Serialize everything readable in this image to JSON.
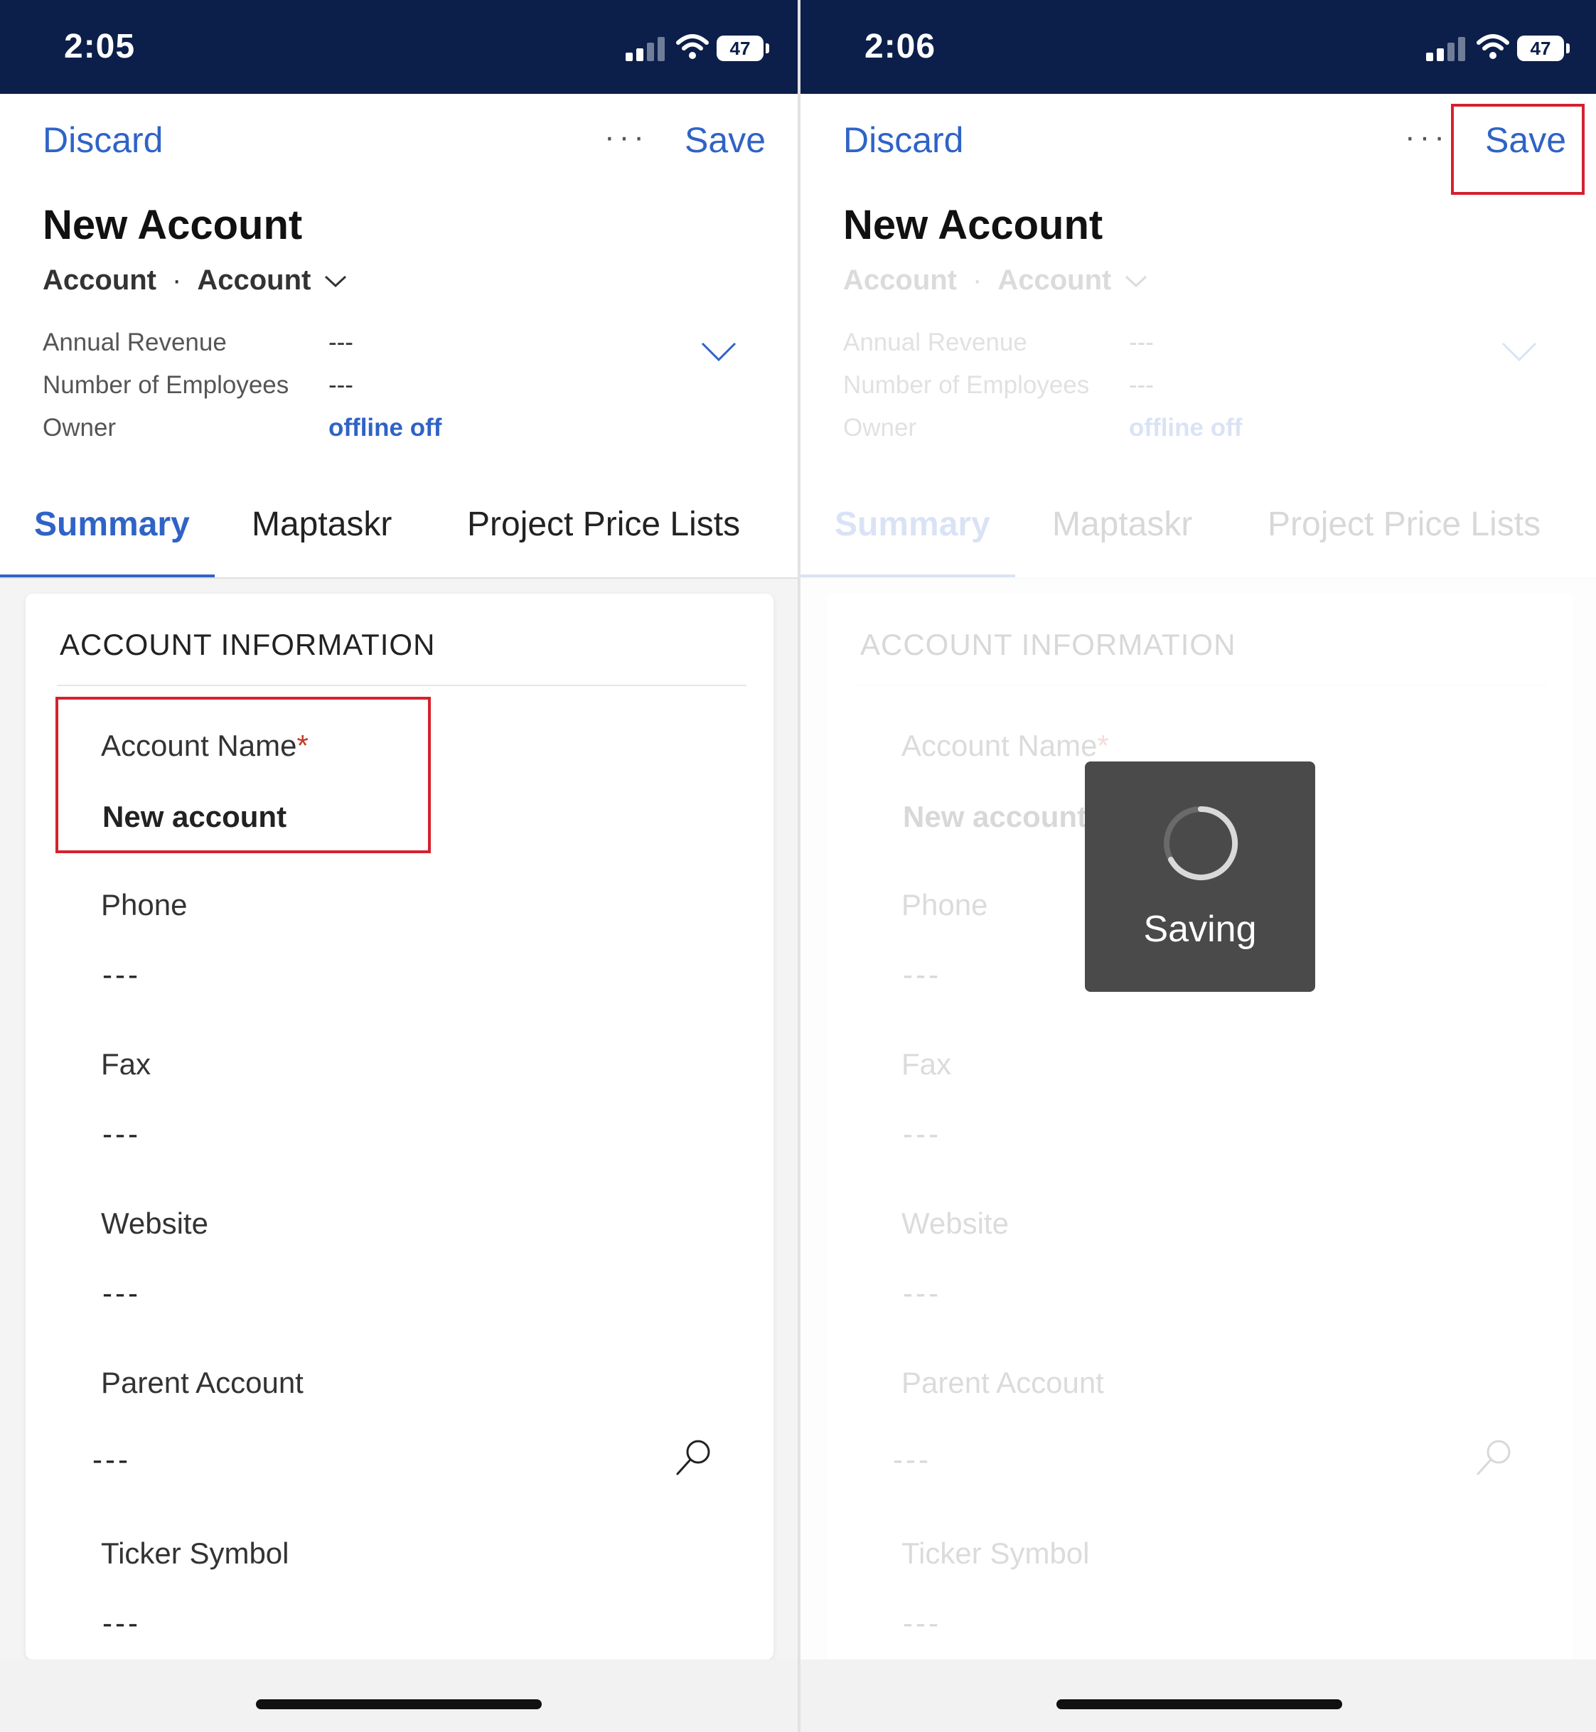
{
  "screens": [
    {
      "status": {
        "time": "2:05",
        "battery": "47"
      },
      "command_bar": {
        "discard": "Discard",
        "more": "···",
        "save": "Save"
      },
      "title": "New Account",
      "subtitle": {
        "entity": "Account",
        "form": "Account"
      },
      "header_fields": [
        {
          "label": "Annual Revenue",
          "value": "---"
        },
        {
          "label": "Number of Employees",
          "value": "---"
        },
        {
          "label": "Owner",
          "value": "offline off"
        }
      ],
      "tabs": [
        "Summary",
        "Maptaskr",
        "Project Price Lists"
      ],
      "active_tab": "Summary",
      "section": {
        "title": "ACCOUNT INFORMATION"
      },
      "fields": [
        {
          "label": "Account Name",
          "required_marker": "*",
          "value": "New account"
        },
        {
          "label": "Phone",
          "value": "---"
        },
        {
          "label": "Fax",
          "value": "---"
        },
        {
          "label": "Website",
          "value": "---"
        },
        {
          "label": "Parent Account",
          "value": "---"
        },
        {
          "label": "Ticker Symbol",
          "value": "---"
        }
      ]
    },
    {
      "status": {
        "time": "2:06",
        "battery": "47"
      },
      "command_bar": {
        "discard": "Discard",
        "more": "···",
        "save": "Save"
      },
      "title": "New Account",
      "subtitle": {
        "entity": "Account",
        "form": "Account"
      },
      "header_fields": [
        {
          "label": "Annual Revenue",
          "value": "---"
        },
        {
          "label": "Number of Employees",
          "value": "---"
        },
        {
          "label": "Owner",
          "value": "offline off"
        }
      ],
      "tabs": [
        "Summary",
        "Maptaskr",
        "Project Price Lists"
      ],
      "active_tab": "Summary",
      "section": {
        "title": "ACCOUNT INFORMATION"
      },
      "fields": [
        {
          "label": "Account Name",
          "required_marker": "*",
          "value": "New account"
        },
        {
          "label": "Phone",
          "value": "---"
        },
        {
          "label": "Fax",
          "value": "---"
        },
        {
          "label": "Website",
          "value": "---"
        },
        {
          "label": "Parent Account",
          "value": "---"
        },
        {
          "label": "Ticker Symbol",
          "value": "---"
        }
      ],
      "overlay": {
        "label": "Saving"
      }
    }
  ],
  "colors": {
    "status_bar": "#0c1f4a",
    "accent": "#2f63c6",
    "highlight": "#d5212f",
    "required": "#c0392b"
  }
}
